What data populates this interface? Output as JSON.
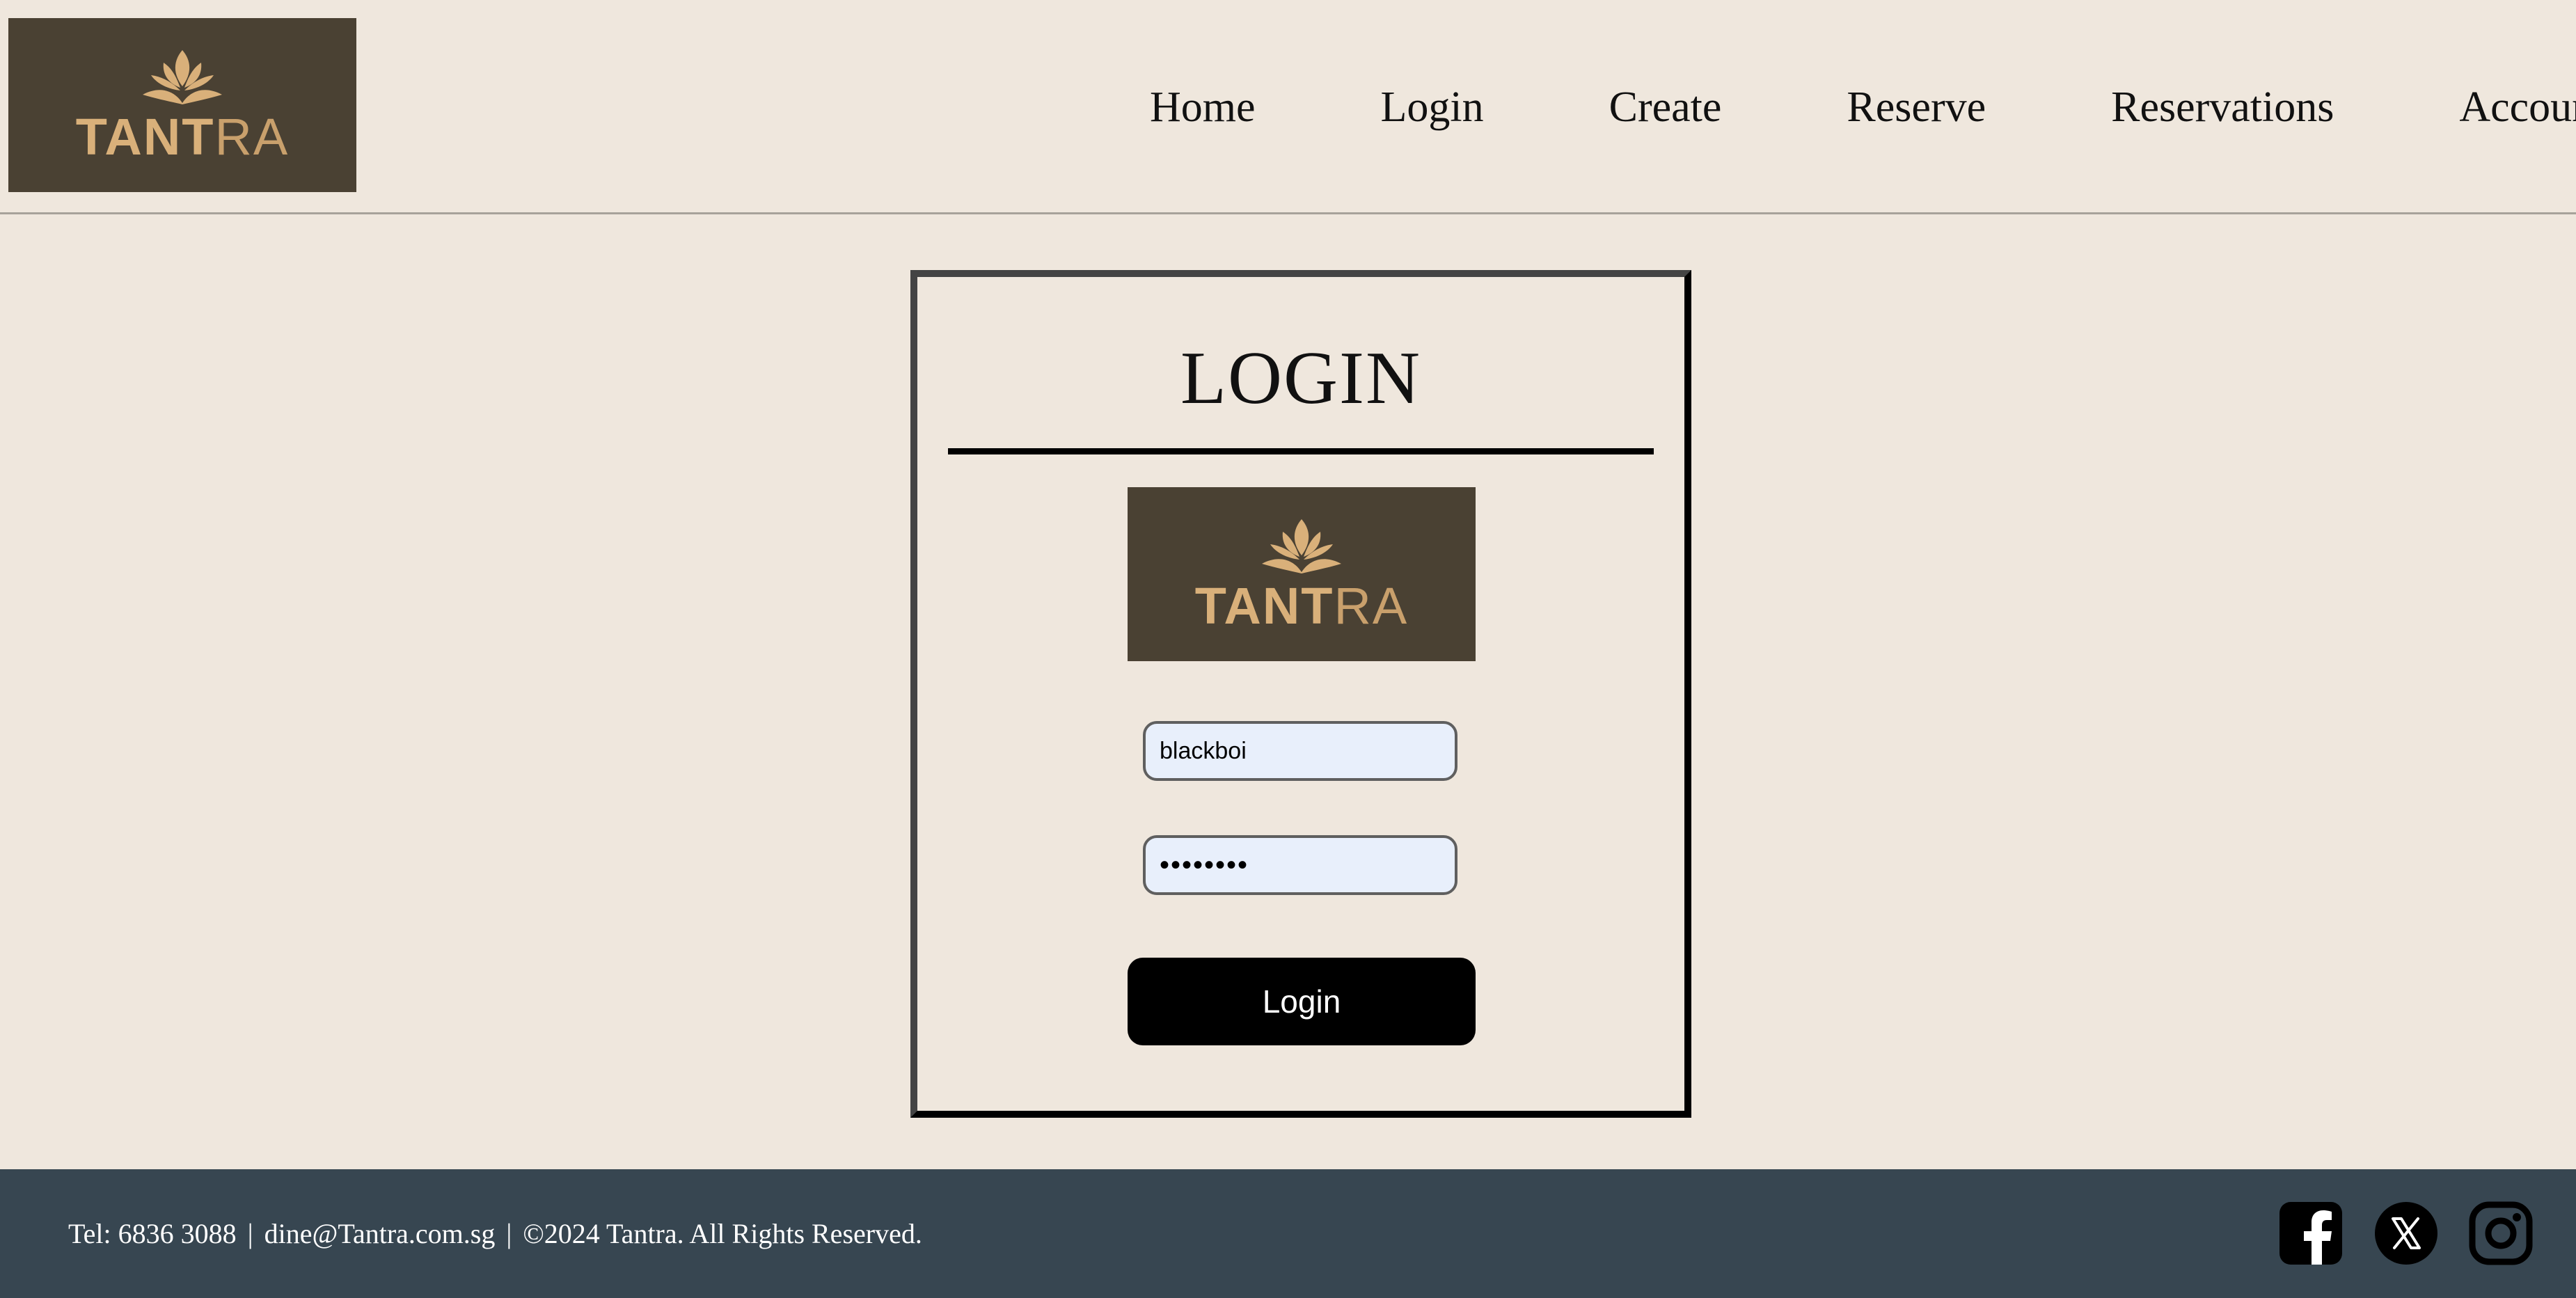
{
  "brand": {
    "logo_bold": "TANT",
    "logo_thin": "RA",
    "bg_color": "#4a4133",
    "accent_color": "#d9b07a"
  },
  "nav": {
    "items": [
      {
        "label": "Home"
      },
      {
        "label": "Login"
      },
      {
        "label": "Create"
      },
      {
        "label": "Reserve"
      },
      {
        "label": "Reservations"
      },
      {
        "label": "Account"
      }
    ]
  },
  "login": {
    "title": "LOGIN",
    "username_value": "blackboi",
    "password_value": "••••••••",
    "submit_label": "Login"
  },
  "footer": {
    "tel": "Tel: 6836 3088",
    "separator": "|",
    "email": "dine@Tantra.com.sg",
    "copyright": "©2024 Tantra. All Rights Reserved.",
    "bg_color": "#374651",
    "social_icons": [
      "facebook-icon",
      "x-icon",
      "instagram-icon"
    ]
  },
  "colors": {
    "page_bg": "#efe7dd",
    "button_bg": "#000000",
    "input_bg": "#e8effb"
  }
}
